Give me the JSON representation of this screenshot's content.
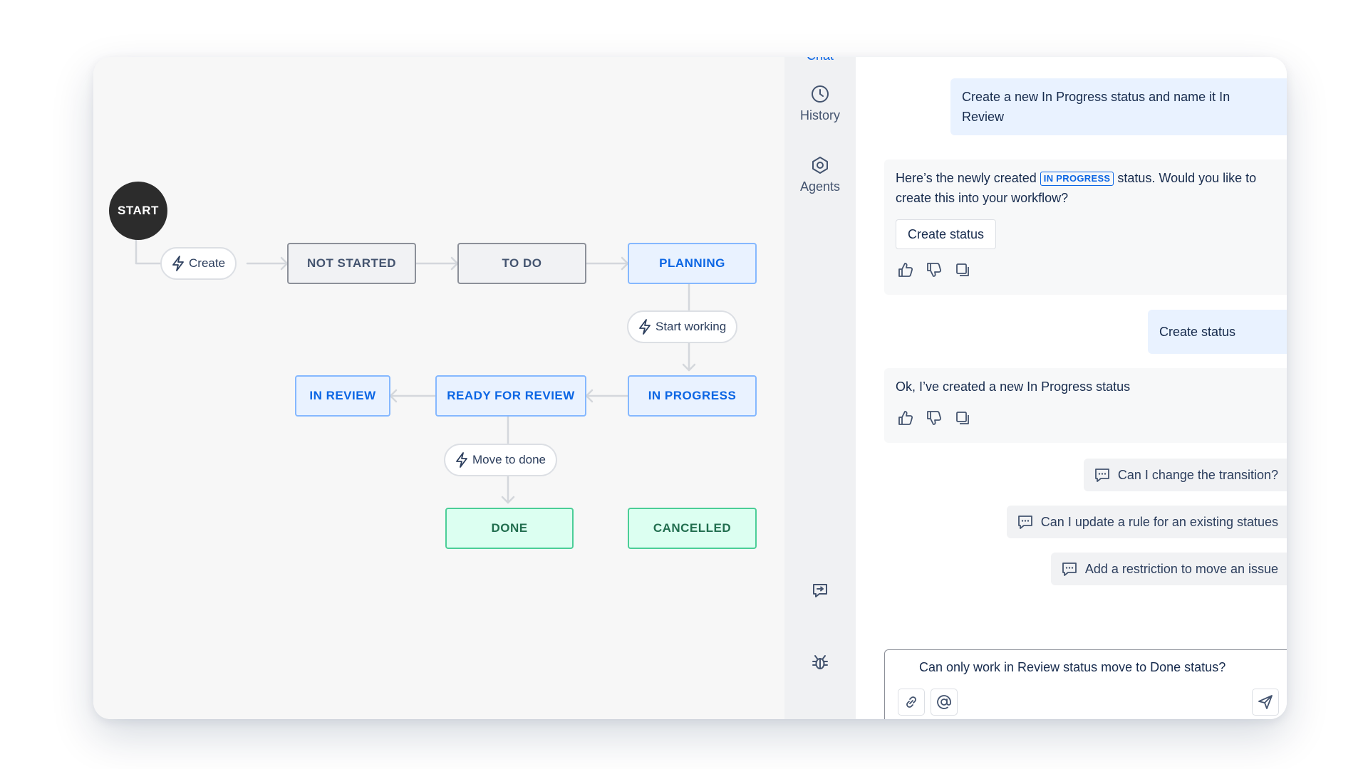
{
  "workflow": {
    "start_label": "START",
    "statuses": {
      "not_started": "NOT STARTED",
      "to_do": "TO DO",
      "planning": "PLANNING",
      "in_progress": "IN PROGRESS",
      "ready_for_review": "READY FOR REVIEW",
      "in_review": "IN REVIEW",
      "done": "DONE",
      "cancelled": "CANCELLED"
    },
    "transitions": {
      "create": "Create",
      "start_working": "Start working",
      "move_to_done": "Move to done"
    }
  },
  "rail": {
    "chat_label": "Chat",
    "history_label": "History",
    "agents_label": "Agents"
  },
  "chat": {
    "messages": [
      {
        "role": "user",
        "text": "Create a new In Progress status and name it In Review"
      },
      {
        "role": "ai",
        "text_before": "Here’s the newly created",
        "lozenge": "IN PROGRESS",
        "text_after": "status. Would you like to create this into your workflow?",
        "button": "Create status"
      },
      {
        "role": "user",
        "text": "Create status"
      },
      {
        "role": "ai",
        "text": "Ok, I’ve created a new In Progress status"
      }
    ],
    "suggestions": [
      "Can I change the transition?",
      "Can I update a rule for an existing statues",
      "Add a restriction to move an issue"
    ],
    "input": {
      "value": "Can only work in Review status move to Done status?"
    }
  },
  "colors": {
    "start_node": "#2c2c2c",
    "blue_status_border": "#85b8ff",
    "blue_status_text": "#0c66e4",
    "green_status_border": "#4bce97",
    "green_status_text": "#216e4e",
    "user_bubble": "#e9f2ff"
  }
}
